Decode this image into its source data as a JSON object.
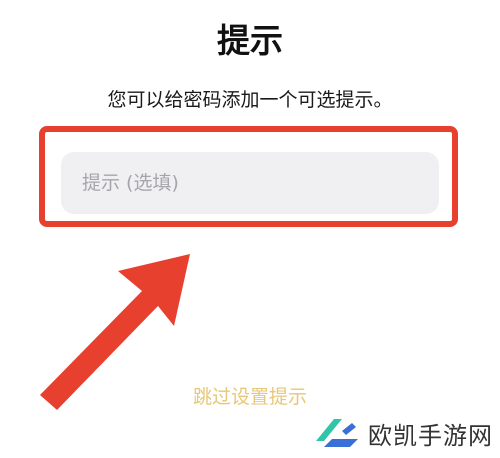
{
  "header": {
    "title": "提示",
    "subtitle": "您可以给密码添加一个可选提示。"
  },
  "hint_field": {
    "placeholder": "提示 (选填)",
    "value": ""
  },
  "skip": {
    "label": "跳过设置提示"
  },
  "watermark": {
    "text": "欧凯手游网",
    "logo_colors": [
      "#2fc5a8",
      "#3a6fd8"
    ]
  },
  "colors": {
    "highlight": "#e8402f",
    "skip_link": "#e7c77a"
  }
}
